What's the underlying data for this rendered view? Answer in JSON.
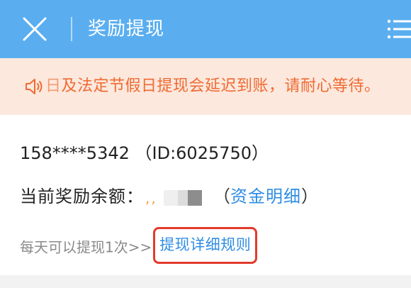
{
  "header": {
    "title": "奖励提现",
    "close_icon": "close-icon",
    "menu_icon": "menu-icon"
  },
  "notice": {
    "icon": "speaker-icon",
    "lead": "日",
    "text": "及法定节假日提现会延迟到账，请耐心等待。"
  },
  "account": {
    "line": "158****5342 （ID:6025750）"
  },
  "balance": {
    "label": "当前奖励余额：",
    "value_masked": ",,",
    "open_paren": "（",
    "close_paren": "）",
    "fund_link": "资金明细"
  },
  "withdraw": {
    "hint": "每天可以提现1次>>",
    "rules_link": "提现详细规则"
  },
  "colors": {
    "header": "#5aaef0",
    "notice_bg": "#fce8dd",
    "notice_text": "#f06a32",
    "link": "#2f8de4",
    "highlight_border": "#e23b2d",
    "masked_value": "#f3a24a"
  }
}
